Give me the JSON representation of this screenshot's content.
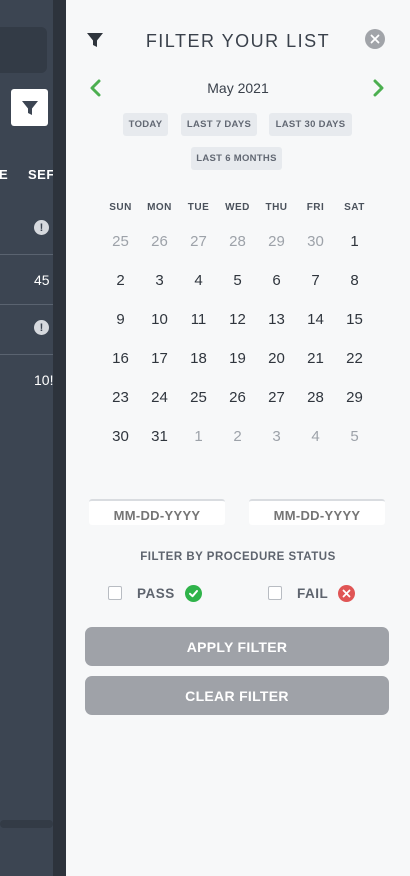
{
  "background": {
    "column_e": "E",
    "column_ser": "SEF",
    "rows": [
      {
        "type": "info",
        "text": "!"
      },
      {
        "type": "value",
        "text": "45"
      },
      {
        "type": "info",
        "text": "!"
      },
      {
        "type": "value",
        "text": "10!"
      }
    ]
  },
  "panel": {
    "title": "FILTER YOUR LIST",
    "filter_icon": "funnel-icon",
    "close_icon": "close-icon",
    "month_label": "May 2021",
    "quick_ranges": [
      "TODAY",
      "LAST 7 DAYS",
      "LAST 30 DAYS",
      "LAST 6 MONTHS"
    ],
    "weekdays": [
      "SUN",
      "MON",
      "TUE",
      "WED",
      "THU",
      "FRI",
      "SAT"
    ],
    "weeks": [
      [
        "25",
        "26",
        "27",
        "28",
        "29",
        "30",
        "1"
      ],
      [
        "2",
        "3",
        "4",
        "5",
        "6",
        "7",
        "8"
      ],
      [
        "9",
        "10",
        "11",
        "12",
        "13",
        "14",
        "15"
      ],
      [
        "16",
        "17",
        "18",
        "19",
        "20",
        "21",
        "22"
      ],
      [
        "23",
        "24",
        "25",
        "26",
        "27",
        "28",
        "29"
      ],
      [
        "30",
        "31",
        "1",
        "2",
        "3",
        "4",
        "5"
      ]
    ],
    "start_date_placeholder": "MM-DD-YYYY",
    "end_date_placeholder": "MM-DD-YYYY",
    "status_title": "FILTER BY PROCEDURE STATUS",
    "pass_label": "PASS",
    "fail_label": "FAIL",
    "apply_label": "APPLY FILTER",
    "clear_label": "CLEAR FILTER"
  },
  "colors": {
    "accent_green": "#4caf50",
    "fail_red": "#e05555",
    "button_gray": "#9fa2a8",
    "sidebar_dark": "#3c4552"
  }
}
